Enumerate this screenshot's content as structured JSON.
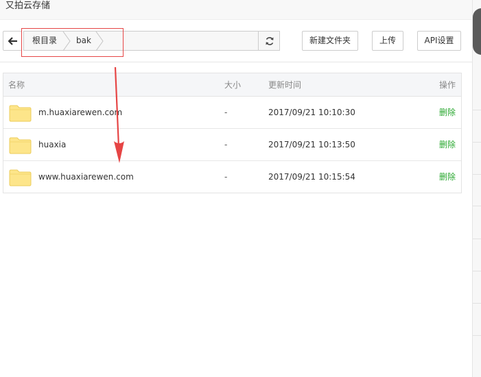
{
  "window": {
    "title": "又拍云存储"
  },
  "toolbar": {
    "back_icon": "arrow-left-icon",
    "breadcrumb": [
      "根目录",
      "bak"
    ],
    "refresh_icon": "refresh-icon",
    "new_folder_label": "新建文件夹",
    "upload_label": "上传",
    "api_settings_label": "API设置"
  },
  "table": {
    "columns": {
      "name": "名称",
      "size": "大小",
      "modified": "更新时间",
      "action": "操作"
    },
    "rows": [
      {
        "icon": "folder-icon",
        "name": "m.huaxiarewen.com",
        "size": "-",
        "modified": "2017/09/21 10:10:30",
        "action": "删除"
      },
      {
        "icon": "folder-icon",
        "name": "huaxia",
        "size": "-",
        "modified": "2017/09/21 10:13:50",
        "action": "删除"
      },
      {
        "icon": "folder-icon",
        "name": "www.huaxiarewen.com",
        "size": "-",
        "modified": "2017/09/21 10:15:54",
        "action": "删除"
      }
    ]
  },
  "colors": {
    "delete_link": "#2aa830",
    "annotation": "#e64545",
    "folder": "#fde58a",
    "header_bg": "#f5f6f8"
  }
}
